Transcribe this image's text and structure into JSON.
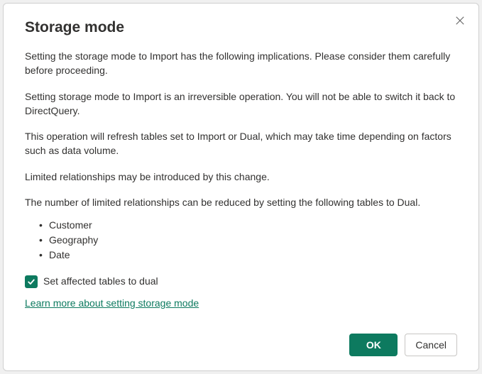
{
  "dialog": {
    "title": "Storage mode",
    "paragraphs": {
      "p1": "Setting the storage mode to Import has the following implications. Please consider them carefully before proceeding.",
      "p2": "Setting storage mode to Import is an irreversible operation.  You will not be able to switch it back to DirectQuery.",
      "p3": "This operation will refresh tables set to Import or Dual, which may take time depending on factors such as data volume.",
      "p4": "Limited relationships may be introduced by this change.",
      "p5": "The number of limited relationships can be reduced by setting the following tables to Dual."
    },
    "dual_tables": [
      "Customer",
      "Geography",
      "Date"
    ],
    "checkbox_label": "Set affected tables to dual",
    "checkbox_checked": true,
    "learn_more_label": "Learn more about setting storage mode",
    "ok_label": "OK",
    "cancel_label": "Cancel"
  }
}
